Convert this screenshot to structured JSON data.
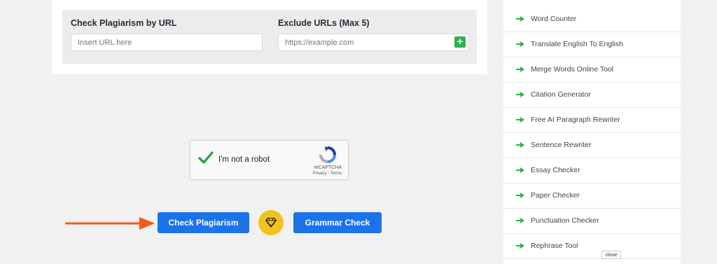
{
  "url_panel": {
    "check_label": "Check Plagiarism by URL",
    "check_placeholder": "Insert URL here",
    "exclude_label": "Exclude URLs (Max 5)",
    "exclude_placeholder": "https://example.com",
    "add_icon": "plus-icon"
  },
  "captcha": {
    "label": "I'm not a robot",
    "brand": "reCAPTCHA",
    "links": "Privacy - Terms"
  },
  "actions": {
    "check_button": "Check Plagiarism",
    "grammar_button": "Grammar Check",
    "premium_icon": "diamond-icon"
  },
  "sidebar": {
    "items": [
      {
        "label": "Word Counter"
      },
      {
        "label": "Translate English To English"
      },
      {
        "label": "Merge Words Online Tool"
      },
      {
        "label": "Citation Generator"
      },
      {
        "label": "Free AI Paragraph Rewriter"
      },
      {
        "label": "Sentence Rewriter"
      },
      {
        "label": "Essay Checker"
      },
      {
        "label": "Paper Checker"
      },
      {
        "label": "Punctuation Checker"
      },
      {
        "label": "Rephrase Tool"
      }
    ]
  },
  "overlay": {
    "close_label": "close"
  },
  "colors": {
    "accent_blue": "#1a73e8",
    "green": "#2cb24b",
    "arrow_orange": "#f05a1a",
    "gold": "#f3c21c"
  }
}
